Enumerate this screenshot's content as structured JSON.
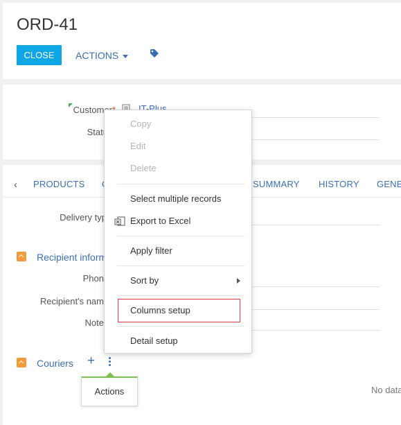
{
  "header": {
    "title": "ORD-41",
    "close_label": "CLOSE",
    "actions_label": "ACTIONS",
    "tag_icon": "tag-icon"
  },
  "fields": {
    "customer_label": "Customer",
    "customer_required": "*",
    "customer_value": "IT-Plus",
    "status_label": "Statu"
  },
  "tabs": {
    "items": [
      "PRODUCTS",
      "C",
      "SUMMARY",
      "HISTORY",
      "GENE"
    ]
  },
  "details": {
    "delivery_type_label": "Delivery typ",
    "recipient_group_title": "Recipient inform",
    "phone_label": "Phon",
    "recipient_name_label": "Recipient's nam",
    "notes_label": "Note",
    "couriers_title": "Couriers",
    "couriers_add": "+",
    "no_data": "No data"
  },
  "tooltip": {
    "text": "Actions"
  },
  "context_menu": {
    "items": [
      {
        "label": "Copy",
        "enabled": false
      },
      {
        "label": "Edit",
        "enabled": false
      },
      {
        "label": "Delete",
        "enabled": false
      },
      {
        "label": "Select multiple records",
        "enabled": true
      },
      {
        "label": "Export to Excel",
        "enabled": true,
        "icon": "excel-icon"
      },
      {
        "label": "Apply filter",
        "enabled": true
      },
      {
        "label": "Sort by",
        "enabled": true,
        "has_submenu": true
      },
      {
        "label": "Columns setup",
        "enabled": true,
        "highlighted": true
      },
      {
        "label": "Detail setup",
        "enabled": true
      }
    ]
  },
  "colors": {
    "accent_blue": "#0fa6e5",
    "link_blue": "#3a6fb7",
    "group_orange": "#f39a3c",
    "highlight_red": "#e0383e",
    "tooltip_green": "#7ec352"
  }
}
